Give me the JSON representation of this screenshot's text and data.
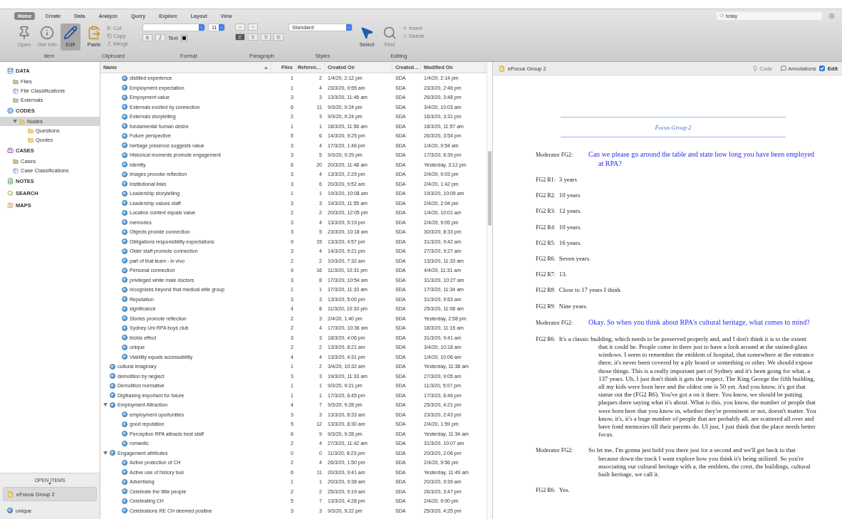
{
  "toolbar": {
    "tabs": [
      {
        "label": "Home",
        "selected": true
      },
      {
        "label": "Create",
        "selected": false
      },
      {
        "label": "Data",
        "selected": false
      },
      {
        "label": "Analyze",
        "selected": false
      },
      {
        "label": "Query",
        "selected": false
      },
      {
        "label": "Explore",
        "selected": false
      },
      {
        "label": "Layout",
        "selected": false
      },
      {
        "label": "View",
        "selected": false
      }
    ],
    "search": {
      "value": "today"
    },
    "item_group": {
      "label": "Item",
      "tools": [
        {
          "kind": "open",
          "label": "Open",
          "disabled": true,
          "on": false
        },
        {
          "kind": "info",
          "label": "Get Info",
          "disabled": true,
          "on": false
        },
        {
          "kind": "edit",
          "label": "Edit",
          "disabled": false,
          "on": true
        }
      ]
    },
    "clipboard_group": {
      "label": "Clipboard",
      "tools": [
        {
          "kind": "paste",
          "label": "Paste",
          "disabled": false,
          "on": false
        },
        {
          "kind": "cut",
          "label": "Cut",
          "disabled": true,
          "on": false
        },
        {
          "kind": "copy",
          "label": "Copy",
          "disabled": true,
          "on": false
        },
        {
          "kind": "merge",
          "label": "Merge",
          "disabled": true,
          "on": false
        }
      ]
    },
    "format_group": {
      "label": "Format",
      "font_size": "11",
      "text_label": "Text"
    },
    "paragraph_group": {
      "label": "Paragraph"
    },
    "styles_group": {
      "label": "Styles",
      "style": "Standard"
    },
    "editing_group": {
      "label": "Editing",
      "tools": [
        {
          "kind": "select",
          "label": "Select",
          "disabled": false,
          "on": false
        },
        {
          "kind": "find",
          "label": "Find",
          "disabled": true,
          "on": false
        },
        {
          "kind": "insert",
          "label": "Insert",
          "disabled": true,
          "on": false
        },
        {
          "kind": "delete",
          "label": "Delete",
          "disabled": true,
          "on": false
        }
      ]
    }
  },
  "sidebar": {
    "sections": [
      {
        "title": "DATA",
        "kind": "data",
        "items": [
          {
            "label": "Files",
            "kind": "files",
            "selected": false
          },
          {
            "label": "File Classifications",
            "kind": "classifications",
            "selected": false
          },
          {
            "label": "Externals",
            "kind": "files",
            "selected": false
          }
        ]
      },
      {
        "title": "CODES",
        "kind": "codes",
        "items": [
          {
            "label": "Nodes",
            "kind": "nodes",
            "selected": true,
            "expanded": true,
            "children": [
              {
                "label": "Questions",
                "kind": "folder",
                "selected": false
              },
              {
                "label": "Quotes",
                "kind": "folder",
                "selected": false
              }
            ]
          }
        ]
      },
      {
        "title": "CASES",
        "kind": "cases",
        "items": [
          {
            "label": "Cases",
            "kind": "files",
            "selected": false
          },
          {
            "label": "Case Classifications",
            "kind": "classifications",
            "selected": false
          }
        ]
      },
      {
        "title": "NOTES",
        "kind": "notes"
      },
      {
        "title": "SEARCH",
        "kind": "search"
      },
      {
        "title": "MAPS",
        "kind": "maps"
      }
    ],
    "open_items": {
      "title": "OPEN ITEMS",
      "items": [
        {
          "label": "eFocus Group 2",
          "kind": "document",
          "selected": true
        },
        {
          "label": "unique",
          "kind": "node",
          "selected": false
        }
      ]
    }
  },
  "table": {
    "columns": [
      "Name",
      "Files",
      "Referen…",
      "Created On",
      "Created…",
      "Modified On"
    ],
    "rows": [
      {
        "children": [
          {
            "name": "distilled experience",
            "files": "1",
            "refs": "2",
            "created": "1/4/20, 2:12 pm",
            "by": "SDA",
            "modified": "1/4/20, 2:14 pm"
          },
          {
            "name": "Employment expectation",
            "files": "1",
            "refs": "4",
            "created": "23/3/20, 9:55 am",
            "by": "SDA",
            "modified": "23/3/20, 2:46 pm"
          },
          {
            "name": "Empoyment value",
            "files": "3",
            "refs": "3",
            "created": "13/3/20, 11:46 am",
            "by": "SDA",
            "modified": "26/3/20, 3:48 pm"
          },
          {
            "name": "Externals excited by connection",
            "files": "6",
            "refs": "11",
            "created": "9/3/20, 9:24 pm",
            "by": "SDA",
            "modified": "3/4/20, 10:03 am"
          },
          {
            "name": "Externals storytelling",
            "files": "2",
            "refs": "3",
            "created": "9/3/20, 9:24 pm",
            "by": "SDA",
            "modified": "16/3/20, 3:31 pm"
          },
          {
            "name": "fundamental human desire",
            "files": "1",
            "refs": "1",
            "created": "18/3/20, 11:56 am",
            "by": "SDA",
            "modified": "18/3/20, 11:57 am"
          },
          {
            "name": "Future perspective",
            "files": "5",
            "refs": "6",
            "created": "14/3/20, 9:25 pm",
            "by": "SDA",
            "modified": "26/3/20, 3:54 pm"
          },
          {
            "name": "hertiage presence suggests value",
            "files": "3",
            "refs": "4",
            "created": "17/3/20, 1:46 pm",
            "by": "SDA",
            "modified": "1/4/20, 9:54 am"
          },
          {
            "name": "Historical moments promote engagement",
            "files": "3",
            "refs": "5",
            "created": "9/3/20, 9:29 pm",
            "by": "SDA",
            "modified": "17/3/20, 6:39 pm"
          },
          {
            "name": "Identity",
            "files": "6",
            "refs": "20",
            "created": "20/3/20, 11:48 am",
            "by": "SDA",
            "modified": "Yesterday, 3:12 pm"
          },
          {
            "name": "Images provoke reflection",
            "files": "3",
            "refs": "4",
            "created": "13/3/20, 2:29 pm",
            "by": "SDA",
            "modified": "2/4/20, 9:03 pm"
          },
          {
            "name": "Institutional links",
            "files": "3",
            "refs": "6",
            "created": "20/3/20, 9:52 am",
            "by": "SDA",
            "modified": "2/4/20, 1:42 pm"
          },
          {
            "name": "Leadership storytelling",
            "files": "1",
            "refs": "1",
            "created": "19/3/20, 10:08 am",
            "by": "SDA",
            "modified": "19/3/20, 10:09 am"
          },
          {
            "name": "Leadership values staff",
            "files": "3",
            "refs": "3",
            "created": "19/3/20, 11:55 am",
            "by": "SDA",
            "modified": "2/4/20, 2:04 pm"
          },
          {
            "name": "Location context equals value",
            "files": "2",
            "refs": "2",
            "created": "20/3/20, 12:05 pm",
            "by": "SDA",
            "modified": "1/4/20, 10:01 am"
          },
          {
            "name": "memories",
            "files": "3",
            "refs": "4",
            "created": "13/3/20, 5:19 pm",
            "by": "SDA",
            "modified": "2/4/20, 9:05 pm"
          },
          {
            "name": "Objects provide connection",
            "files": "3",
            "refs": "5",
            "created": "23/3/20, 10:18 am",
            "by": "SDA",
            "modified": "30/3/20, 8:33 pm"
          },
          {
            "name": "Obligations responsibility expectations",
            "files": "9",
            "refs": "15",
            "created": "13/3/20, 4:57 pm",
            "by": "SDA",
            "modified": "31/3/20, 9:42 am"
          },
          {
            "name": "Older staff promote connection",
            "files": "3",
            "refs": "4",
            "created": "14/3/20, 9:21 pm",
            "by": "SDA",
            "modified": "27/3/20, 9:27 am"
          },
          {
            "name": "part of that team - in vivo",
            "files": "2",
            "refs": "2",
            "created": "10/3/20, 7:32 am",
            "by": "SDA",
            "modified": "13/3/20, 11:33 am"
          },
          {
            "name": "Personal connection",
            "files": "9",
            "refs": "16",
            "created": "11/3/20, 10:31 pm",
            "by": "SDA",
            "modified": "4/4/20, 11:31 am"
          },
          {
            "name": "privileged white male doctors",
            "files": "3",
            "refs": "8",
            "created": "17/3/20, 10:54 am",
            "by": "SDA",
            "modified": "31/3/20, 10:27 am"
          },
          {
            "name": "recognizes beyond that medical elite group",
            "files": "1",
            "refs": "1",
            "created": "17/3/20, 11:33 am",
            "by": "SDA",
            "modified": "17/3/20, 11:34 am"
          },
          {
            "name": "Reputation",
            "files": "3",
            "refs": "3",
            "created": "13/3/20, 5:00 pm",
            "by": "SDA",
            "modified": "31/3/20, 9:53 am"
          },
          {
            "name": "significance",
            "files": "4",
            "refs": "8",
            "created": "11/3/20, 10:33 pm",
            "by": "SDA",
            "modified": "25/3/20, 11:08 am"
          },
          {
            "name": "Stories promote reflection",
            "files": "2",
            "refs": "3",
            "created": "2/4/20, 1:40 pm",
            "by": "SDA",
            "modified": "Yesterday, 2:58 pm"
          },
          {
            "name": "Sydney Uni RPA boys club",
            "files": "2",
            "refs": "4",
            "created": "17/3/20, 10:36 am",
            "by": "SDA",
            "modified": "18/3/20, 11:15 am"
          },
          {
            "name": "trickle effect",
            "files": "3",
            "refs": "3",
            "created": "18/3/20, 4:06 pm",
            "by": "SDA",
            "modified": "31/3/20, 9:41 am"
          },
          {
            "name": "unique",
            "files": "2",
            "refs": "2",
            "created": "13/3/20, 8:21 am",
            "by": "SDA",
            "modified": "3/4/20, 10:18 am"
          },
          {
            "name": "Viability equals accessability",
            "files": "4",
            "refs": "4",
            "created": "13/3/20, 4:31 pm",
            "by": "SDA",
            "modified": "1/4/20, 10:06 am"
          }
        ]
      },
      {
        "name": "cultural imaginary",
        "files": "1",
        "refs": "2",
        "created": "3/4/20, 10:32 am",
        "by": "SDA",
        "modified": "Yesterday, 11:38 am"
      },
      {
        "name": "demolition by neglect",
        "files": "3",
        "refs": "3",
        "created": "19/3/20, 11:33 am",
        "by": "SDA",
        "modified": "27/3/20, 9:05 am"
      },
      {
        "name": "Demolition normative",
        "files": "1",
        "refs": "1",
        "created": "9/3/20, 9:21 pm",
        "by": "SDA",
        "modified": "11/3/20, 5:07 pm"
      },
      {
        "name": "Digitiasing important for future",
        "files": "1",
        "refs": "1",
        "created": "17/3/20, 6:45 pm",
        "by": "SDA",
        "modified": "17/3/20, 6:46 pm"
      },
      {
        "name": "Employment Attraction",
        "files": "4",
        "refs": "7",
        "created": "9/3/20, 9:28 pm",
        "by": "SDA",
        "modified": "25/3/20, 4:21 pm",
        "expanded": true,
        "children": [
          {
            "name": "employment oportunities",
            "files": "3",
            "refs": "3",
            "created": "13/3/20, 8:33 am",
            "by": "SDA",
            "modified": "23/3/20, 2:43 pm"
          },
          {
            "name": "good reputation",
            "files": "5",
            "refs": "12",
            "created": "13/3/20, 8:30 am",
            "by": "SDA",
            "modified": "2/4/20, 1:59 pm"
          },
          {
            "name": "Perception RPA attracts best staff",
            "files": "6",
            "refs": "9",
            "created": "9/3/20, 9:28 pm",
            "by": "SDA",
            "modified": "Yesterday, 11:34 am"
          },
          {
            "name": "romantic",
            "files": "2",
            "refs": "4",
            "created": "27/3/20, 11:42 am",
            "by": "SDA",
            "modified": "31/3/20, 10:07 am"
          }
        ]
      },
      {
        "name": "Engagement attributes",
        "files": "0",
        "refs": "0",
        "created": "11/3/20, 8:23 pm",
        "by": "SDA",
        "modified": "20/3/20, 2:06 pm",
        "expanded": true,
        "children": [
          {
            "name": "Active protection of CH",
            "files": "2",
            "refs": "4",
            "created": "26/3/20, 1:50 pm",
            "by": "SDA",
            "modified": "2/4/20, 9:56 pm"
          },
          {
            "name": "Active use of history tool",
            "files": "6",
            "refs": "11",
            "created": "20/3/20, 9:41 am",
            "by": "SDA",
            "modified": "Yesterday, 11:49 am"
          },
          {
            "name": "Advertising",
            "files": "1",
            "refs": "1",
            "created": "20/3/20, 9:38 am",
            "by": "SDA",
            "modified": "20/3/20, 9:39 am"
          },
          {
            "name": "Celebrate the little people",
            "files": "2",
            "refs": "2",
            "created": "25/3/20, 9:19 am",
            "by": "SDA",
            "modified": "26/3/20, 3:47 pm"
          },
          {
            "name": "Celebrating CH",
            "files": "5",
            "refs": "7",
            "created": "13/3/20, 4:28 pm",
            "by": "SDA",
            "modified": "2/4/20, 9:00 pm"
          },
          {
            "name": "Celebrations RE CH deemed positive",
            "files": "3",
            "refs": "3",
            "created": "9/3/20, 9:22 pm",
            "by": "SDA",
            "modified": "25/3/20, 4:25 pm"
          }
        ]
      }
    ]
  },
  "document": {
    "tab": {
      "title": "eFocus Group 2",
      "code_label": "Code",
      "code_disabled": true,
      "annotations_label": "Annotations",
      "edit_label": "Edit",
      "edit_checked": true
    },
    "title": "Focus Group 2",
    "entries": [
      {
        "kind": "question",
        "speaker": "Moderator FG2:",
        "text": "Can we please go around the table and state how long you have been employed at RPA?"
      },
      {
        "kind": "answer",
        "speaker": "FG2 R1:",
        "text": "3 years"
      },
      {
        "kind": "answer",
        "speaker": "FG2 R2:",
        "text": "10 years"
      },
      {
        "kind": "answer",
        "speaker": "FG2 R3:",
        "text": "12 years."
      },
      {
        "kind": "answer",
        "speaker": "FG2 R4:",
        "text": "10 years."
      },
      {
        "kind": "answer",
        "speaker": "FG2 R5:",
        "text": "16 years."
      },
      {
        "kind": "answer",
        "speaker": "FG2 R6:",
        "text": "Seven years."
      },
      {
        "kind": "answer",
        "speaker": "FG2 R7:",
        "text": "13."
      },
      {
        "kind": "answer",
        "speaker": "FG2 R8:",
        "text": "Close to 17 years I think"
      },
      {
        "kind": "answer",
        "speaker": "FG2 R9:",
        "text": "Nine years."
      },
      {
        "kind": "question",
        "speaker": "Moderator FG2:",
        "text": "Okay. So when you think about RPA's cultural heritage, what comes to mind?"
      },
      {
        "kind": "answer",
        "speaker": "FG2 R6:",
        "text": "It's a classic building, which needs to be preserved properly and, and I don't think it is to the extent that it could be. People come in there just to have a look around at the stained-glass windows. I seem to remember the emblem of hospital, that somewhere at the entrance there, it's never been covered by a ply board or something or other. We should expose those things. This is a really important part of Sydney and it's been going for what, a 137 years. Uh, I just don't think it gets the respect. The King George the fifth building, all my kids were born here and the oldest one is 50 yet. And you know, it's got that statue out the (FG2 R6). You've got a on it there. You know, we should be putting plaques there saying what it's about. What is this, you know, the number of people that were born here that you know in, whether they're prominent or not, doesn't matter. You know, it's, it's a huge number of people that are probably all, are scattered all over and have fond memories till their parents do. Ul just, I just think that the place needs better focus."
      },
      {
        "kind": "moderator",
        "speaker": "Moderator FG2:",
        "text": "So let me, I'm gonna just hold you there just for a second and we'll get back to that because down the track I want explore how you think it's being utilized. So you're associating our cultural heritage with a, the emblem, the crest, the buildings, cultural built heritage, we call it."
      },
      {
        "kind": "answer",
        "speaker": "FG2 R6:",
        "text": "Yes."
      }
    ]
  }
}
